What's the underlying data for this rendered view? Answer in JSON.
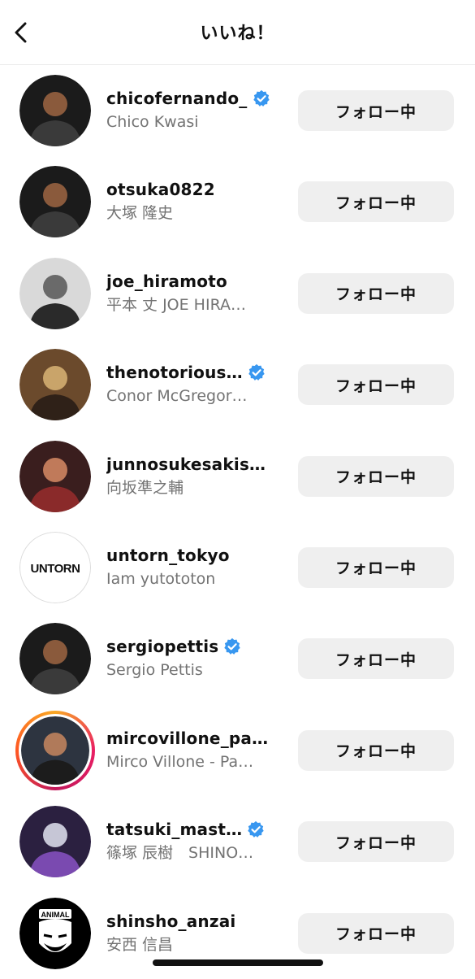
{
  "header": {
    "title": "いいね！",
    "back_icon": "chevron-left-icon"
  },
  "colors": {
    "verified": "#3897f0",
    "button_bg": "#efefef",
    "secondary_text": "#737373",
    "story_ring": "#e91e63"
  },
  "users": [
    {
      "username": "chicofernando_",
      "fullname": "Chico Kwasi",
      "verified": true,
      "story_ring": false,
      "button": "フォロー中",
      "avatar_style": "dark"
    },
    {
      "username": "otsuka0822",
      "fullname": "大塚 隆史",
      "verified": false,
      "story_ring": false,
      "button": "フォロー中",
      "avatar_style": "dark"
    },
    {
      "username": "joe_hiramoto",
      "fullname": "平本 丈 JOE HIRA…",
      "verified": false,
      "story_ring": false,
      "button": "フォロー中",
      "avatar_style": "mono"
    },
    {
      "username": "thenotorious…",
      "fullname": "Conor McGregor…",
      "verified": true,
      "story_ring": false,
      "button": "フォロー中",
      "avatar_style": "warm"
    },
    {
      "username": "junnosukesakisaka",
      "fullname": "向坂準之輔",
      "verified": false,
      "story_ring": false,
      "button": "フォロー中",
      "avatar_style": "red"
    },
    {
      "username": "untorn_tokyo",
      "fullname": "Iam yutototon",
      "verified": false,
      "story_ring": false,
      "button": "フォロー中",
      "avatar_style": "logo",
      "avatar_text": "UNTORN"
    },
    {
      "username": "sergiopettis",
      "fullname": "Sergio Pettis",
      "verified": true,
      "story_ring": false,
      "button": "フォロー中",
      "avatar_style": "dark"
    },
    {
      "username": "mircovillone_pa…",
      "fullname": "Mirco Villone - Pa…",
      "verified": false,
      "story_ring": true,
      "button": "フォロー中",
      "avatar_style": "gym"
    },
    {
      "username": "tatsuki_mast…",
      "fullname": "篠塚 辰樹　SHINO…",
      "verified": true,
      "story_ring": false,
      "button": "フォロー中",
      "avatar_style": "purple"
    },
    {
      "username": "shinsho_anzai",
      "fullname": "安西 信昌",
      "verified": false,
      "story_ring": false,
      "button": "フォロー中",
      "avatar_style": "animal",
      "avatar_text": "ANIMAL"
    }
  ]
}
